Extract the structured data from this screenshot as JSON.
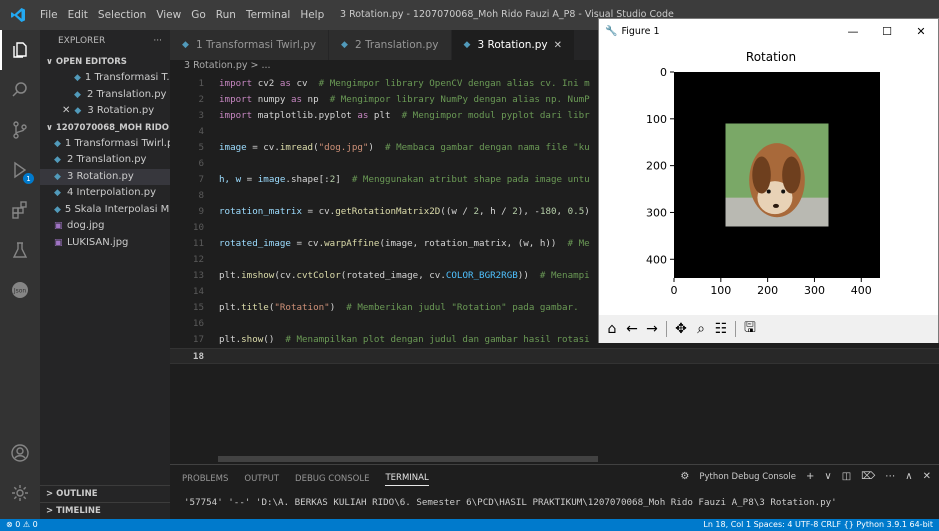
{
  "titlebar": {
    "menu": [
      "File",
      "Edit",
      "Selection",
      "View",
      "Go",
      "Run",
      "Terminal",
      "Help"
    ],
    "window_title": "3 Rotation.py - 1207070068_Moh Rido Fauzi A_P8 - Visual Studio Code"
  },
  "sidebar": {
    "header": "EXPLORER",
    "more": "···",
    "open_editors_label": "OPEN EDITORS",
    "open_editors": [
      {
        "label": "1 Transformasi T...",
        "close": false
      },
      {
        "label": "2 Translation.py",
        "close": false
      },
      {
        "label": "3 Rotation.py",
        "close": true
      }
    ],
    "folder_label": "1207070068_MOH RIDO F...",
    "files": [
      {
        "label": "1 Transformasi Twirl.py",
        "kind": "py"
      },
      {
        "label": "2 Translation.py",
        "kind": "py"
      },
      {
        "label": "3 Rotation.py",
        "kind": "py",
        "active": true
      },
      {
        "label": "4 Interpolation.py",
        "kind": "py"
      },
      {
        "label": "5 Skala Interpolasi Mi...",
        "kind": "py"
      },
      {
        "label": "dog.jpg",
        "kind": "img"
      },
      {
        "label": "LUKISAN.jpg",
        "kind": "img"
      }
    ],
    "outline_label": "OUTLINE",
    "timeline_label": "TIMELINE"
  },
  "tabs": [
    {
      "label": "1 Transformasi Twirl.py",
      "active": false
    },
    {
      "label": "2 Translation.py",
      "active": false
    },
    {
      "label": "3 Rotation.py",
      "active": true,
      "close": "✕"
    }
  ],
  "breadcrumb": "3 Rotation.py > ...",
  "editor": {
    "line_numbers": [
      "1",
      "2",
      "3",
      "4",
      "5",
      "6",
      "7",
      "8",
      "9",
      "10",
      "11",
      "12",
      "13",
      "14",
      "15",
      "16",
      "17",
      "18"
    ],
    "code": {
      "l1": [
        "import",
        " cv2 ",
        "as",
        " cv ",
        " # Mengimpor library OpenCV dengan alias cv. Ini m"
      ],
      "l2": [
        "import",
        " numpy ",
        "as",
        " np ",
        " # Mengimpor library NumPy dengan alias np. NumP"
      ],
      "l3": [
        "import",
        " matplotlib.pyplot ",
        "as",
        " plt ",
        " # Mengimpor modul pyplot dari libr"
      ],
      "l5": [
        "image",
        " = cv.",
        "imread",
        "(",
        "\"dog.jpg\"",
        ")  ",
        "# Membaca gambar dengan nama file \"ku"
      ],
      "l7": [
        "h, w",
        " = ",
        "image",
        ".shape[:",
        "2",
        "]  ",
        "# Menggunakan atribut shape pada image untu"
      ],
      "l9": [
        "rotation_matrix",
        " = cv.",
        "getRotationMatrix2D",
        "((w / ",
        "2",
        ", h / ",
        "2",
        "), -",
        "180",
        ", ",
        "0.5",
        ")"
      ],
      "l11": [
        "rotated_image",
        " = cv.",
        "warpAffine",
        "(image, rotation_matrix, (w, h))  ",
        "# Me"
      ],
      "l13": [
        "plt.",
        "imshow",
        "(cv.",
        "cvtColor",
        "(rotated_image, cv.",
        "COLOR_BGR2RGB",
        "))  ",
        "# Menampi"
      ],
      "l15": [
        "plt.",
        "title",
        "(",
        "\"Rotation\"",
        ")  ",
        "# Memberikan judul \"Rotation\" pada gambar."
      ],
      "l17": [
        "plt.",
        "show",
        "()  ",
        "# Menampilkan plot dengan judul dan gambar hasil rotasi"
      ]
    }
  },
  "panel": {
    "tabs": [
      "PROBLEMS",
      "OUTPUT",
      "DEBUG CONSOLE",
      "TERMINAL"
    ],
    "active_tab": "TERMINAL",
    "console_label": "Python Debug Console",
    "terminal_line": "'57754' '--' 'D:\\A. BERKAS KULIAH RIDO\\6. Semester 6\\PCD\\HASIL PRAKTIKUM\\1207070068_Moh Rido Fauzi A_P8\\3 Rotation.py'"
  },
  "statusbar": {
    "left": "⊗ 0  ⚠ 0",
    "right": "Ln 18, Col 1   Spaces: 4   UTF-8   CRLF   {} Python   3.9.1 64-bit"
  },
  "figure": {
    "window_title": "Figure 1",
    "controls": [
      "—",
      "☐",
      "✕"
    ]
  },
  "chart_data": {
    "type": "image",
    "title": "Rotation",
    "xticks": [
      "0",
      "100",
      "200",
      "300",
      "400"
    ],
    "yticks": [
      "0",
      "100",
      "200",
      "300",
      "400"
    ],
    "xlim": [
      0,
      440
    ],
    "ylim": [
      440,
      0
    ],
    "image_extent_data": {
      "x": [
        0,
        440
      ],
      "y": [
        0,
        440
      ]
    },
    "content_box_data": {
      "x": [
        110,
        330
      ],
      "y": [
        110,
        330
      ]
    }
  },
  "colors": {
    "accent": "#007acc",
    "editor_bg": "#1e1e1e",
    "keyword": "#c586c0",
    "function": "#dcdcaa",
    "string": "#ce9178",
    "comment": "#6a9955"
  }
}
